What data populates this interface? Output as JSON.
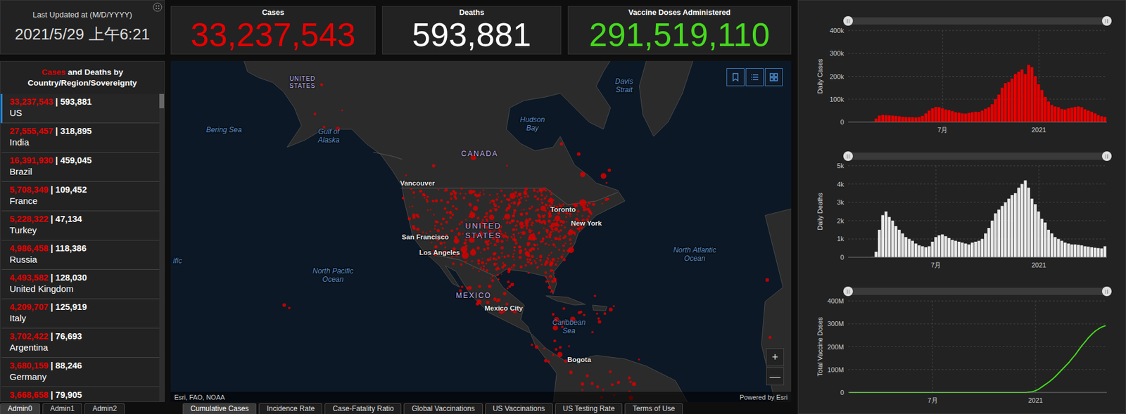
{
  "header": {
    "updated_label": "Last Updated at (M/D/YYYY)",
    "updated_value": "2021/5/29 上午6:21"
  },
  "stats": [
    {
      "label": "Cases",
      "value": "33,237,543",
      "color": "#e60000"
    },
    {
      "label": "Deaths",
      "value": "593,881",
      "color": "#ffffff"
    },
    {
      "label": "Vaccine Doses Administered",
      "value": "291,519,110",
      "color": "#46d91e"
    }
  ],
  "list": {
    "title": [
      {
        "text": "Cases",
        "color": "#e60000"
      },
      {
        "text": " and ",
        "color": "#ffffff"
      },
      {
        "text": "Deaths",
        "color": "#ffffff"
      },
      {
        "text": " by Country/Region/Sovereignty",
        "color": "#ffffff"
      }
    ],
    "separator": "|",
    "rows": [
      {
        "cases": "33,237,543",
        "deaths": "593,881",
        "name": "US",
        "selected": true
      },
      {
        "cases": "27,555,457",
        "deaths": "318,895",
        "name": "India",
        "selected": false
      },
      {
        "cases": "16,391,930",
        "deaths": "459,045",
        "name": "Brazil",
        "selected": false
      },
      {
        "cases": "5,708,349",
        "deaths": "109,452",
        "name": "France",
        "selected": false
      },
      {
        "cases": "5,228,322",
        "deaths": "47,134",
        "name": "Turkey",
        "selected": false
      },
      {
        "cases": "4,986,458",
        "deaths": "118,386",
        "name": "Russia",
        "selected": false
      },
      {
        "cases": "4,493,582",
        "deaths": "128,030",
        "name": "United Kingdom",
        "selected": false
      },
      {
        "cases": "4,209,707",
        "deaths": "125,919",
        "name": "Italy",
        "selected": false
      },
      {
        "cases": "3,702,422",
        "deaths": "76,693",
        "name": "Argentina",
        "selected": false
      },
      {
        "cases": "3,680,159",
        "deaths": "88,246",
        "name": "Germany",
        "selected": false
      },
      {
        "cases": "3,668,658",
        "deaths": "79,905",
        "selected": false
      }
    ]
  },
  "admin_tabs": [
    {
      "label": "Admin0",
      "selected": true
    },
    {
      "label": "Admin1",
      "selected": false
    },
    {
      "label": "Admin2",
      "selected": false
    }
  ],
  "map": {
    "labels": [
      {
        "text": "UNITED STATES",
        "kind": "country"
      },
      {
        "text": "Bering Sea",
        "kind": "water"
      },
      {
        "text": "Gulf of Alaska",
        "kind": "water"
      },
      {
        "text": "CANADA",
        "kind": "country"
      },
      {
        "text": "Hudson Bay",
        "kind": "water"
      },
      {
        "text": "Davis Strait",
        "kind": "water"
      },
      {
        "text": "Vancouver",
        "kind": "city"
      },
      {
        "text": "Toronto",
        "kind": "city"
      },
      {
        "text": "New York",
        "kind": "city"
      },
      {
        "text": "San Francisco",
        "kind": "city"
      },
      {
        "text": "Los Angeles",
        "kind": "city"
      },
      {
        "text": "UNITED STATES",
        "kind": "country"
      },
      {
        "text": "North Pacific Ocean",
        "kind": "water"
      },
      {
        "text": "North Atlantic Ocean",
        "kind": "water"
      },
      {
        "text": "MEXICO",
        "kind": "country"
      },
      {
        "text": "Mexico City",
        "kind": "city"
      },
      {
        "text": "Caribbean Sea",
        "kind": "water"
      },
      {
        "text": "Bogota",
        "kind": "city"
      },
      {
        "text": "ific",
        "kind": "water"
      }
    ],
    "zoom_in": "+",
    "zoom_out": "—",
    "attribution": "Esri, FAO, NOAA",
    "powered_by": "Powered by Esri"
  },
  "main_tabs": [
    {
      "label": "Cumulative Cases",
      "selected": true
    },
    {
      "label": "Incidence Rate",
      "selected": false
    },
    {
      "label": "Case-Fatality Ratio",
      "selected": false
    },
    {
      "label": "Global Vaccinations",
      "selected": false
    },
    {
      "label": "US Vaccinations",
      "selected": false
    },
    {
      "label": "US Testing Rate",
      "selected": false
    },
    {
      "label": "Terms of Use",
      "selected": false
    }
  ],
  "charts": [
    {
      "y_label": "Daily Cases",
      "kind": "bars",
      "color": "#e60000",
      "y_max": 400000,
      "slider": {
        "start": 0,
        "end": 1
      },
      "y_ticks": [
        {
          "label": "400k",
          "value": 400000
        },
        {
          "label": "300k",
          "value": 300000
        },
        {
          "label": "200k",
          "value": 200000
        },
        {
          "label": "100k",
          "value": 100000
        },
        {
          "label": "0",
          "value": 0
        }
      ],
      "x_ticks": [
        {
          "label": "7月",
          "index": 28
        },
        {
          "label": "2021",
          "index": 57
        }
      ],
      "values": [
        0,
        0,
        0,
        0,
        0,
        0,
        100,
        2000,
        15000,
        28000,
        31000,
        30000,
        29000,
        28000,
        27000,
        25000,
        23000,
        22000,
        21000,
        21000,
        20000,
        22000,
        27000,
        38000,
        50000,
        60000,
        66000,
        65000,
        60000,
        55000,
        52000,
        48000,
        43000,
        41000,
        38000,
        37000,
        40000,
        43000,
        45000,
        44000,
        50000,
        58000,
        65000,
        78000,
        100000,
        120000,
        150000,
        170000,
        175000,
        190000,
        210000,
        220000,
        230000,
        210000,
        250000,
        240000,
        200000,
        165000,
        140000,
        110000,
        90000,
        75000,
        68000,
        65000,
        57000,
        55000,
        60000,
        63000,
        66000,
        68000,
        65000,
        56000,
        50000,
        45000,
        38000,
        30000,
        25000,
        22000
      ]
    },
    {
      "y_label": "Daily Deaths",
      "kind": "bars",
      "color": "#e8e8e8",
      "y_max": 5000,
      "slider": {
        "start": 0,
        "end": 1
      },
      "y_ticks": [
        {
          "label": "5k",
          "value": 5000
        },
        {
          "label": "4k",
          "value": 4000
        },
        {
          "label": "3k",
          "value": 3000
        },
        {
          "label": "2k",
          "value": 2000
        },
        {
          "label": "1k",
          "value": 1000
        },
        {
          "label": "0",
          "value": 0
        }
      ],
      "x_ticks": [
        {
          "label": "7月",
          "index": 26
        },
        {
          "label": "2021",
          "index": 57
        }
      ],
      "values": [
        0,
        0,
        0,
        0,
        0,
        0,
        0,
        10,
        300,
        1500,
        2300,
        2500,
        2200,
        2000,
        1700,
        1500,
        1300,
        1100,
        1000,
        900,
        750,
        650,
        600,
        550,
        600,
        850,
        1100,
        1200,
        1250,
        1150,
        1050,
        950,
        900,
        850,
        800,
        750,
        700,
        800,
        850,
        900,
        1000,
        1300,
        1600,
        2000,
        2400,
        2600,
        2800,
        3000,
        3200,
        3400,
        3500,
        3800,
        4000,
        4200,
        3800,
        3200,
        2900,
        2500,
        2100,
        1900,
        1500,
        1300,
        1100,
        1000,
        900,
        800,
        750,
        700,
        700,
        680,
        650,
        600,
        580,
        550,
        520,
        500,
        480,
        600
      ]
    },
    {
      "y_label": "Total Vaccine Doses",
      "kind": "line",
      "color": "#46d91e",
      "y_max": 400000000,
      "slider": {
        "start": 0,
        "end": 1
      },
      "y_ticks": [
        {
          "label": "400M",
          "value": 400000000
        },
        {
          "label": "300M",
          "value": 300000000
        },
        {
          "label": "200M",
          "value": 200000000
        },
        {
          "label": "100M",
          "value": 100000000
        },
        {
          "label": "0",
          "value": 0
        }
      ],
      "x_ticks": [
        {
          "label": "7月",
          "index": 25
        },
        {
          "label": "2021",
          "index": 56
        }
      ],
      "values": [
        0,
        0,
        0,
        0,
        0,
        0,
        0,
        0,
        0,
        0,
        0,
        0,
        0,
        0,
        0,
        0,
        0,
        0,
        0,
        0,
        0,
        0,
        0,
        0,
        0,
        0,
        0,
        0,
        0,
        0,
        0,
        0,
        0,
        0,
        0,
        0,
        0,
        0,
        0,
        0,
        0,
        0,
        0,
        0,
        0,
        0,
        0,
        0,
        0,
        0,
        0,
        0,
        0,
        0,
        1000000,
        3000000,
        8000000,
        15000000,
        25000000,
        35000000,
        45000000,
        57000000,
        70000000,
        85000000,
        100000000,
        115000000,
        130000000,
        148000000,
        165000000,
        185000000,
        205000000,
        222000000,
        240000000,
        255000000,
        268000000,
        278000000,
        286000000,
        291500000
      ]
    }
  ]
}
